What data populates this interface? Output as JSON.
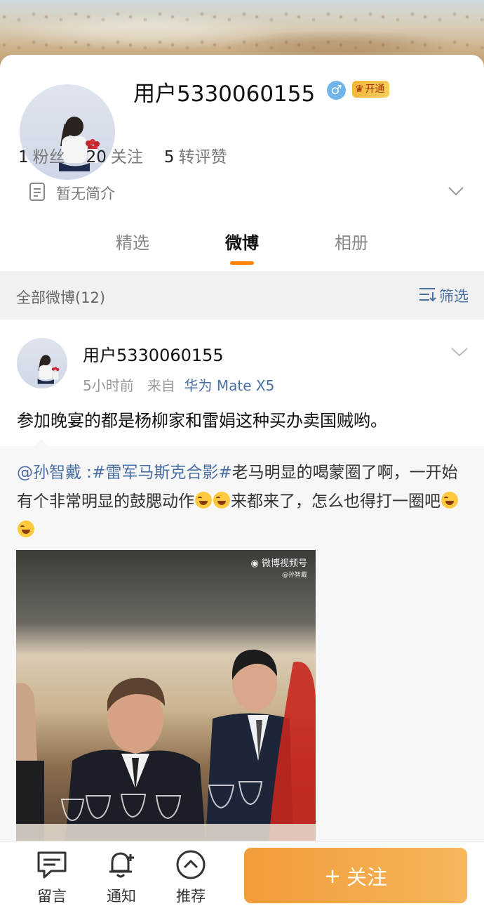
{
  "profile": {
    "username": "用户5330060155",
    "vip_badge": "开通",
    "stats": [
      {
        "num": "1",
        "label": "粉丝"
      },
      {
        "num": "20",
        "label": "关注"
      },
      {
        "num": "5",
        "label": "转评赞"
      }
    ],
    "bio": "暂无简介",
    "tabs": [
      "精选",
      "微博",
      "相册"
    ],
    "active_tab": "微博"
  },
  "filter": {
    "label": "全部微博(12)",
    "button": "筛选"
  },
  "post": {
    "username": "用户5330060155",
    "time": "5小时前",
    "source_prefix": "来自",
    "device": "华为 Mate X5",
    "text": "参加晚宴的都是杨柳家和雷娟这种买办卖国贼哟。",
    "repost": {
      "mention": "@孙智戴",
      "sep": " :",
      "hashtag": "#雷军马斯克合影#",
      "text_a": "老马明显的喝蒙圈了啊，一开始有个非常明显的鼓腮动作",
      "text_b": "来都来了，怎么也得打一圈吧",
      "video_watermark": "微博视频号",
      "video_watermark_sub": "@孙智戴"
    }
  },
  "bottom_bar": {
    "comment": "留言",
    "notify": "通知",
    "recommend": "推荐",
    "follow": "关注"
  },
  "colors": {
    "accent": "#ff8200",
    "link": "#4a6fa5",
    "follow_button": "#f3a644"
  }
}
